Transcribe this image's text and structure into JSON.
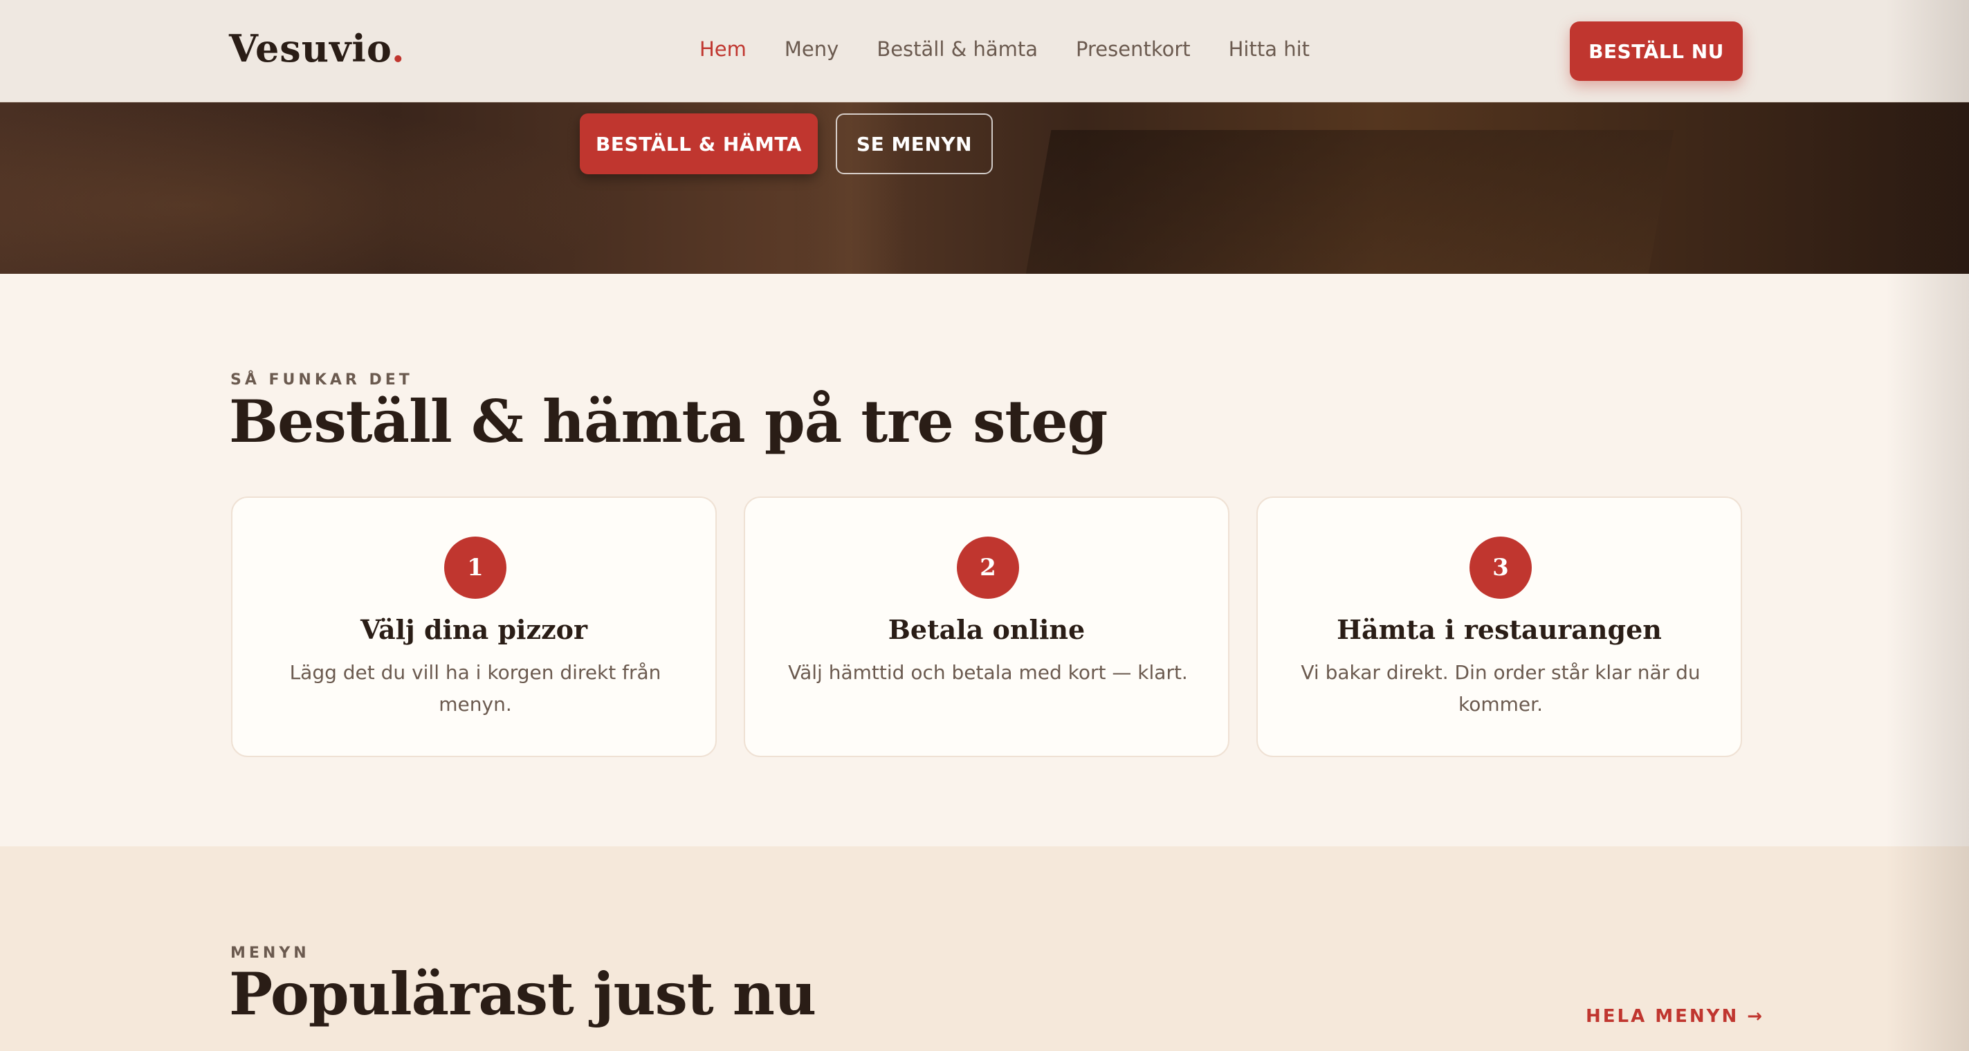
{
  "header": {
    "logo_text": "Vesuvio",
    "logo_dot": ".",
    "nav": [
      {
        "label": "Hem",
        "active": true
      },
      {
        "label": "Meny",
        "active": false
      },
      {
        "label": "Beställ & hämta",
        "active": false
      },
      {
        "label": "Presentkort",
        "active": false
      },
      {
        "label": "Hitta hit",
        "active": false
      }
    ],
    "cta_label": "BESTÄLL NU"
  },
  "hero": {
    "primary_label": "BESTÄLL & HÄMTA",
    "secondary_label": "SE MENYN"
  },
  "steps": {
    "eyebrow": "SÅ FUNKAR DET",
    "title": "Beställ & hämta på tre steg",
    "items": [
      {
        "number": "1",
        "title": "Välj dina pizzor",
        "description": "Lägg det du vill ha i korgen direkt från menyn."
      },
      {
        "number": "2",
        "title": "Betala online",
        "description": "Välj hämttid och betala med kort — klart."
      },
      {
        "number": "3",
        "title": "Hämta i restaurangen",
        "description": "Vi bakar direkt. Din order står klar när du kommer."
      }
    ]
  },
  "menu": {
    "eyebrow": "MENYN",
    "title": "Populärast just nu",
    "link_label": "HELA MENYN →"
  },
  "colors": {
    "accent": "#c0362f",
    "text_dark": "#2a1d16",
    "text_muted": "#6b5a4f",
    "header_bg": "#efe8e1",
    "section_bg": "#faf3ec",
    "menu_bg": "#f5e8da"
  }
}
